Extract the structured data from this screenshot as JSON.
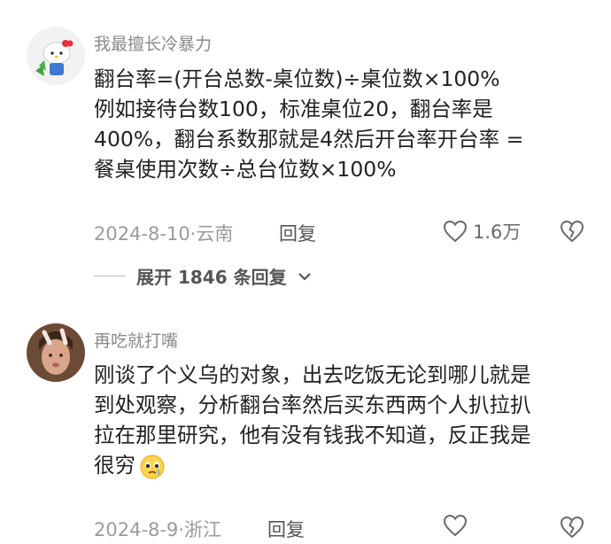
{
  "comments": [
    {
      "username": "我最擅长冷暴力",
      "lines": [
        "翻台率=(开台总数-桌位数)÷桌位数×100%",
        "例如接待台数100，标准桌位20，翻台率是",
        "400%，翻台系数那就是4然后开台率开台率 =",
        "餐桌使用次数÷总台位数×100%"
      ],
      "date": "2024-8-10·云南",
      "reply_label": "回复",
      "like_count": "1.6万"
    },
    {
      "username": "再吃就打嘴",
      "lines": [
        "刚谈了个义乌的对象，出去吃饭无论到哪儿就是",
        "到处观察，分析翻台率然后买东西两个人扒拉扒",
        "拉在那里研究，他有没有钱我不知道，反正我是",
        "很穷"
      ],
      "date": "2024-8-9·浙江",
      "reply_label": "回复"
    }
  ],
  "expand_replies": {
    "label": "展开 1846 条回复"
  },
  "icons": {
    "like": "heart-outline-icon",
    "dislike": "broken-heart-icon",
    "expand": "chevron-down-icon",
    "emoji": "pleading-face-emoji"
  },
  "colors": {
    "text": "#222222",
    "meta": "#9b9b9b",
    "username": "#8a8a8a"
  }
}
